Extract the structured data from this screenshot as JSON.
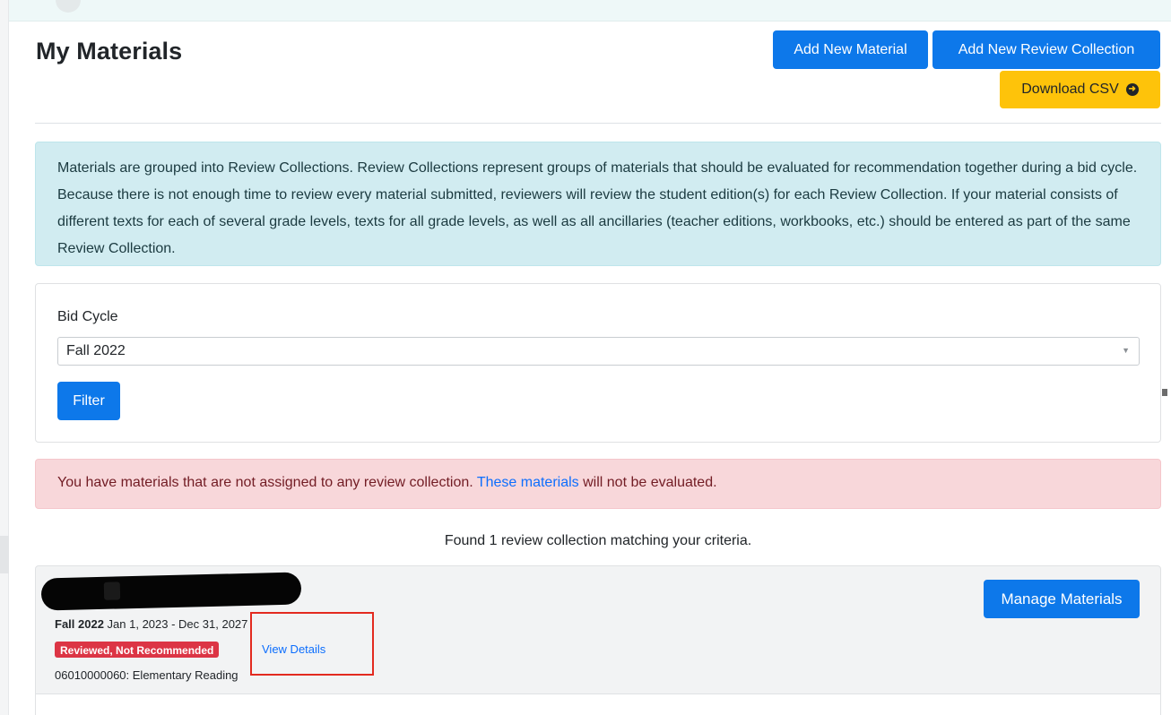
{
  "page": {
    "title": "My Materials"
  },
  "header_actions": {
    "add_material_label": "Add New Material",
    "add_collection_label": "Add New Review Collection",
    "download_csv_label": "Download CSV",
    "download_icon": "arrow-circle-right-icon"
  },
  "info_alert": {
    "text": "Materials are grouped into Review Collections. Review Collections represent groups of materials that should be evaluated for recommendation together during a bid cycle. Because there is not enough time to review every material submitted, reviewers will review the student edition(s) for each Review Collection. If your material consists of different texts for each of several grade levels, texts for all grade levels, as well as all ancillaries (teacher editions, workbooks, etc.) should be entered as part of the same Review Collection."
  },
  "filter": {
    "label": "Bid Cycle",
    "selected": "Fall 2022",
    "button_label": "Filter"
  },
  "danger_alert": {
    "text_before": "You have materials that are not assigned to any review collection. ",
    "link_text": "These materials",
    "text_after": " will not be evaluated."
  },
  "results": {
    "summary": "Found 1 review collection matching your criteria."
  },
  "collection": {
    "cycle": "Fall 2022",
    "date_range": " Jan 1, 2023 - Dec 31, 2027",
    "status_badge": "Reviewed, Not Recommended",
    "view_details_label": "View Details",
    "code": "06010000060: Elementary Reading",
    "manage_button_label": "Manage Materials"
  },
  "colors": {
    "primary": "#0d78ea",
    "warning": "#fec30a",
    "info_bg": "#d1ecf1",
    "danger_bg": "#f8d7da",
    "badge_danger": "#dc3545",
    "highlight": "#e32a1f"
  }
}
